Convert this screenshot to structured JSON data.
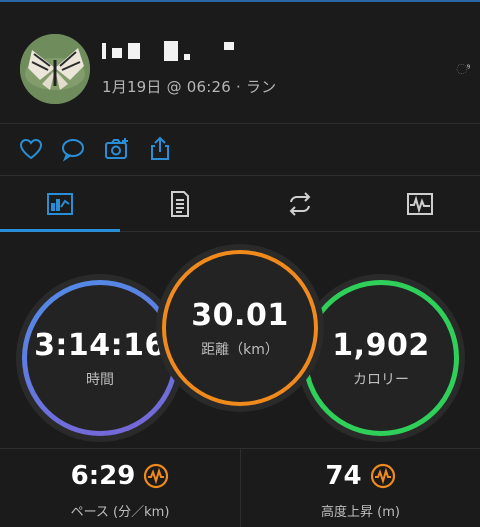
{
  "header": {
    "meta": "1月19日 @ 06:26 · ラン",
    "more_label": "ಿ"
  },
  "actions": {
    "icons": [
      "heart-icon",
      "comment-icon",
      "camera-icon",
      "share-icon"
    ],
    "accent": "#2a8ed6"
  },
  "tabs": {
    "items": [
      "stats-tab",
      "details-tab",
      "laps-tab",
      "charts-tab"
    ],
    "active": 0
  },
  "stats": {
    "time": {
      "value": "3:14:16",
      "label": "時間",
      "color": "#5a84e6"
    },
    "distance": {
      "value": "30.01",
      "label": "距離（km）",
      "color": "#f08a1c"
    },
    "calories": {
      "value": "1,902",
      "label": "カロリー",
      "color": "#2fd05a"
    }
  },
  "metrics": {
    "pace": {
      "value": "6:29",
      "label": "ペース (分／km)"
    },
    "elevation": {
      "value": "74",
      "label": "高度上昇 (m)"
    },
    "icon_color": "#f08a1c"
  }
}
